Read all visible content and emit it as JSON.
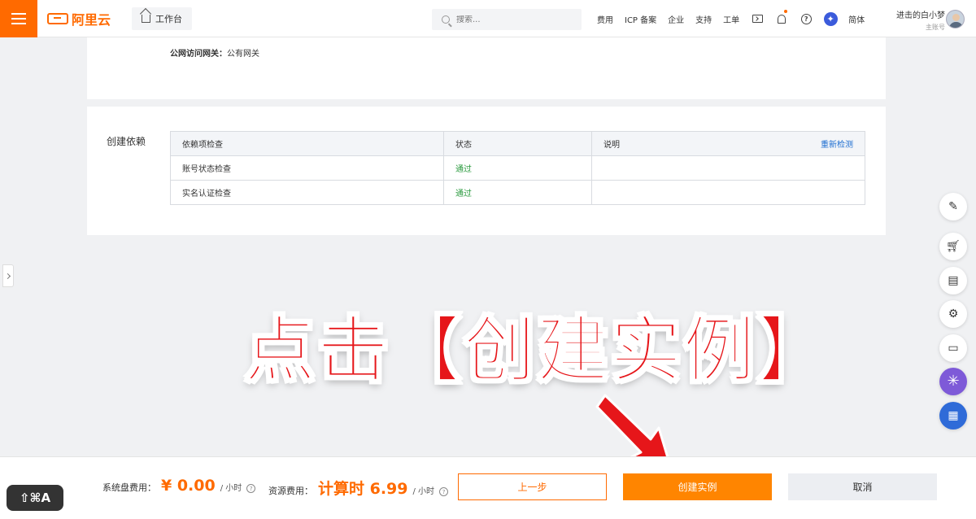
{
  "topbar": {
    "brand": "阿里云",
    "workbench": "工作台",
    "search_placeholder": "搜索...",
    "links": [
      "费用",
      "ICP 备案",
      "企业",
      "支持",
      "工单"
    ],
    "lang": "简体",
    "user_name": "进击的白小梦",
    "user_role": "主账号",
    "icons": [
      "menu-icon",
      "home-icon",
      "search-icon",
      "terminal-icon",
      "bell-icon",
      "help-icon",
      "ai-assistant-icon"
    ]
  },
  "network": {
    "gateway_label": "公网访问网关：",
    "gateway_value": "公有网关"
  },
  "dependency": {
    "title": "创建依赖",
    "headers": [
      "依赖项检查",
      "状态",
      "说明"
    ],
    "recheck": "重新检测",
    "rows": [
      {
        "item": "账号状态检查",
        "status": "通过",
        "note": ""
      },
      {
        "item": "实名认证检查",
        "status": "通过",
        "note": ""
      }
    ]
  },
  "annotation": {
    "text": "点击【创建实例】",
    "color": "#e6161a"
  },
  "footer": {
    "disk_fee_label": "系统盘费用：",
    "disk_fee_amount": "¥ 0.00",
    "disk_fee_unit": "/ 小时",
    "resource_fee_label": "资源费用：",
    "resource_fee_amount": "计算时 6.99",
    "resource_fee_unit": "/ 小时",
    "prev_button": "上一步",
    "create_button": "创建实例",
    "cancel_button": "取消"
  },
  "shortcut_badge": "⇧⌘A",
  "colors": {
    "brand": "#ff6a00",
    "pass": "#2a9a3e",
    "link": "#1c6dd0"
  }
}
